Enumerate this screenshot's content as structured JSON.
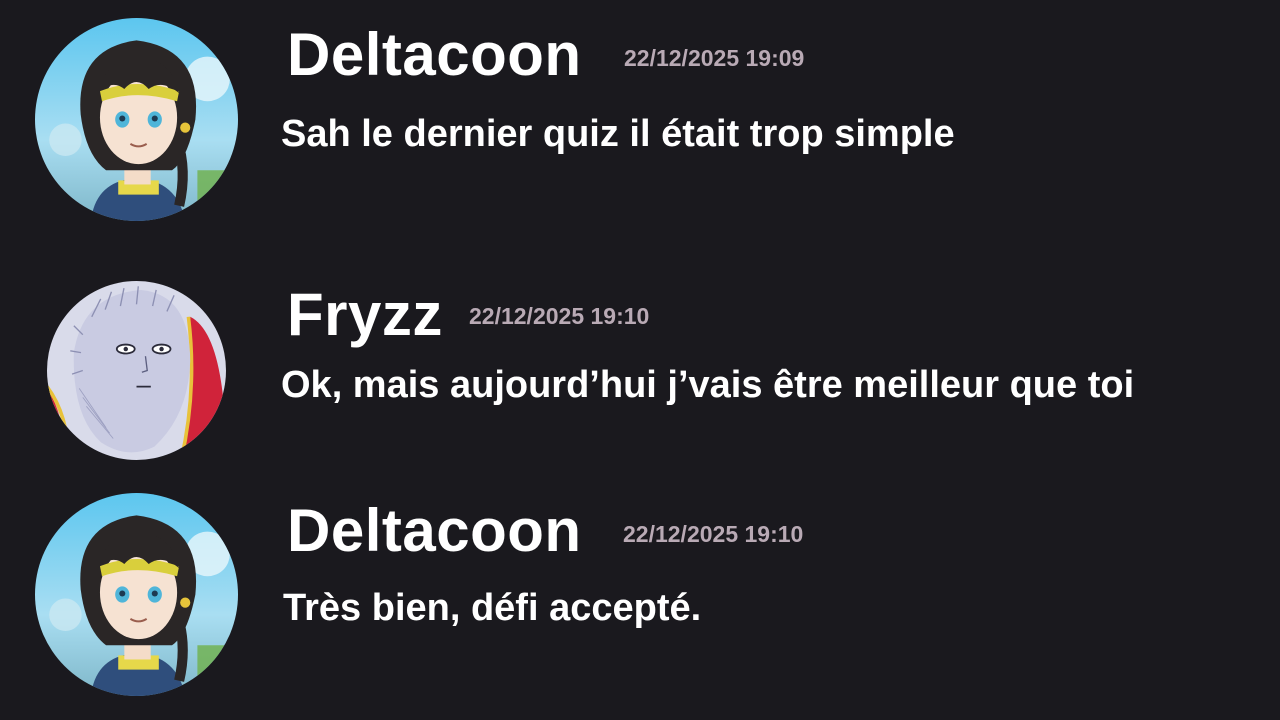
{
  "messages": [
    {
      "author": "Deltacoon",
      "timestamp": "22/12/2025 19:09",
      "content": "Sah le dernier quiz il était trop simple",
      "avatar": "deltacoon-avatar"
    },
    {
      "author": "Fryzz",
      "timestamp": "22/12/2025 19:10",
      "content": "Ok, mais aujourd’hui j’vais être meilleur que toi",
      "avatar": "fryzz-avatar"
    },
    {
      "author": "Deltacoon",
      "timestamp": "22/12/2025 19:10",
      "content": "Très bien, défi accepté.",
      "avatar": "deltacoon-avatar"
    }
  ],
  "colors": {
    "background": "#1a191e",
    "username": "#ffffff",
    "timestamp": "#b9aab5",
    "message_text": "#ffffff"
  }
}
